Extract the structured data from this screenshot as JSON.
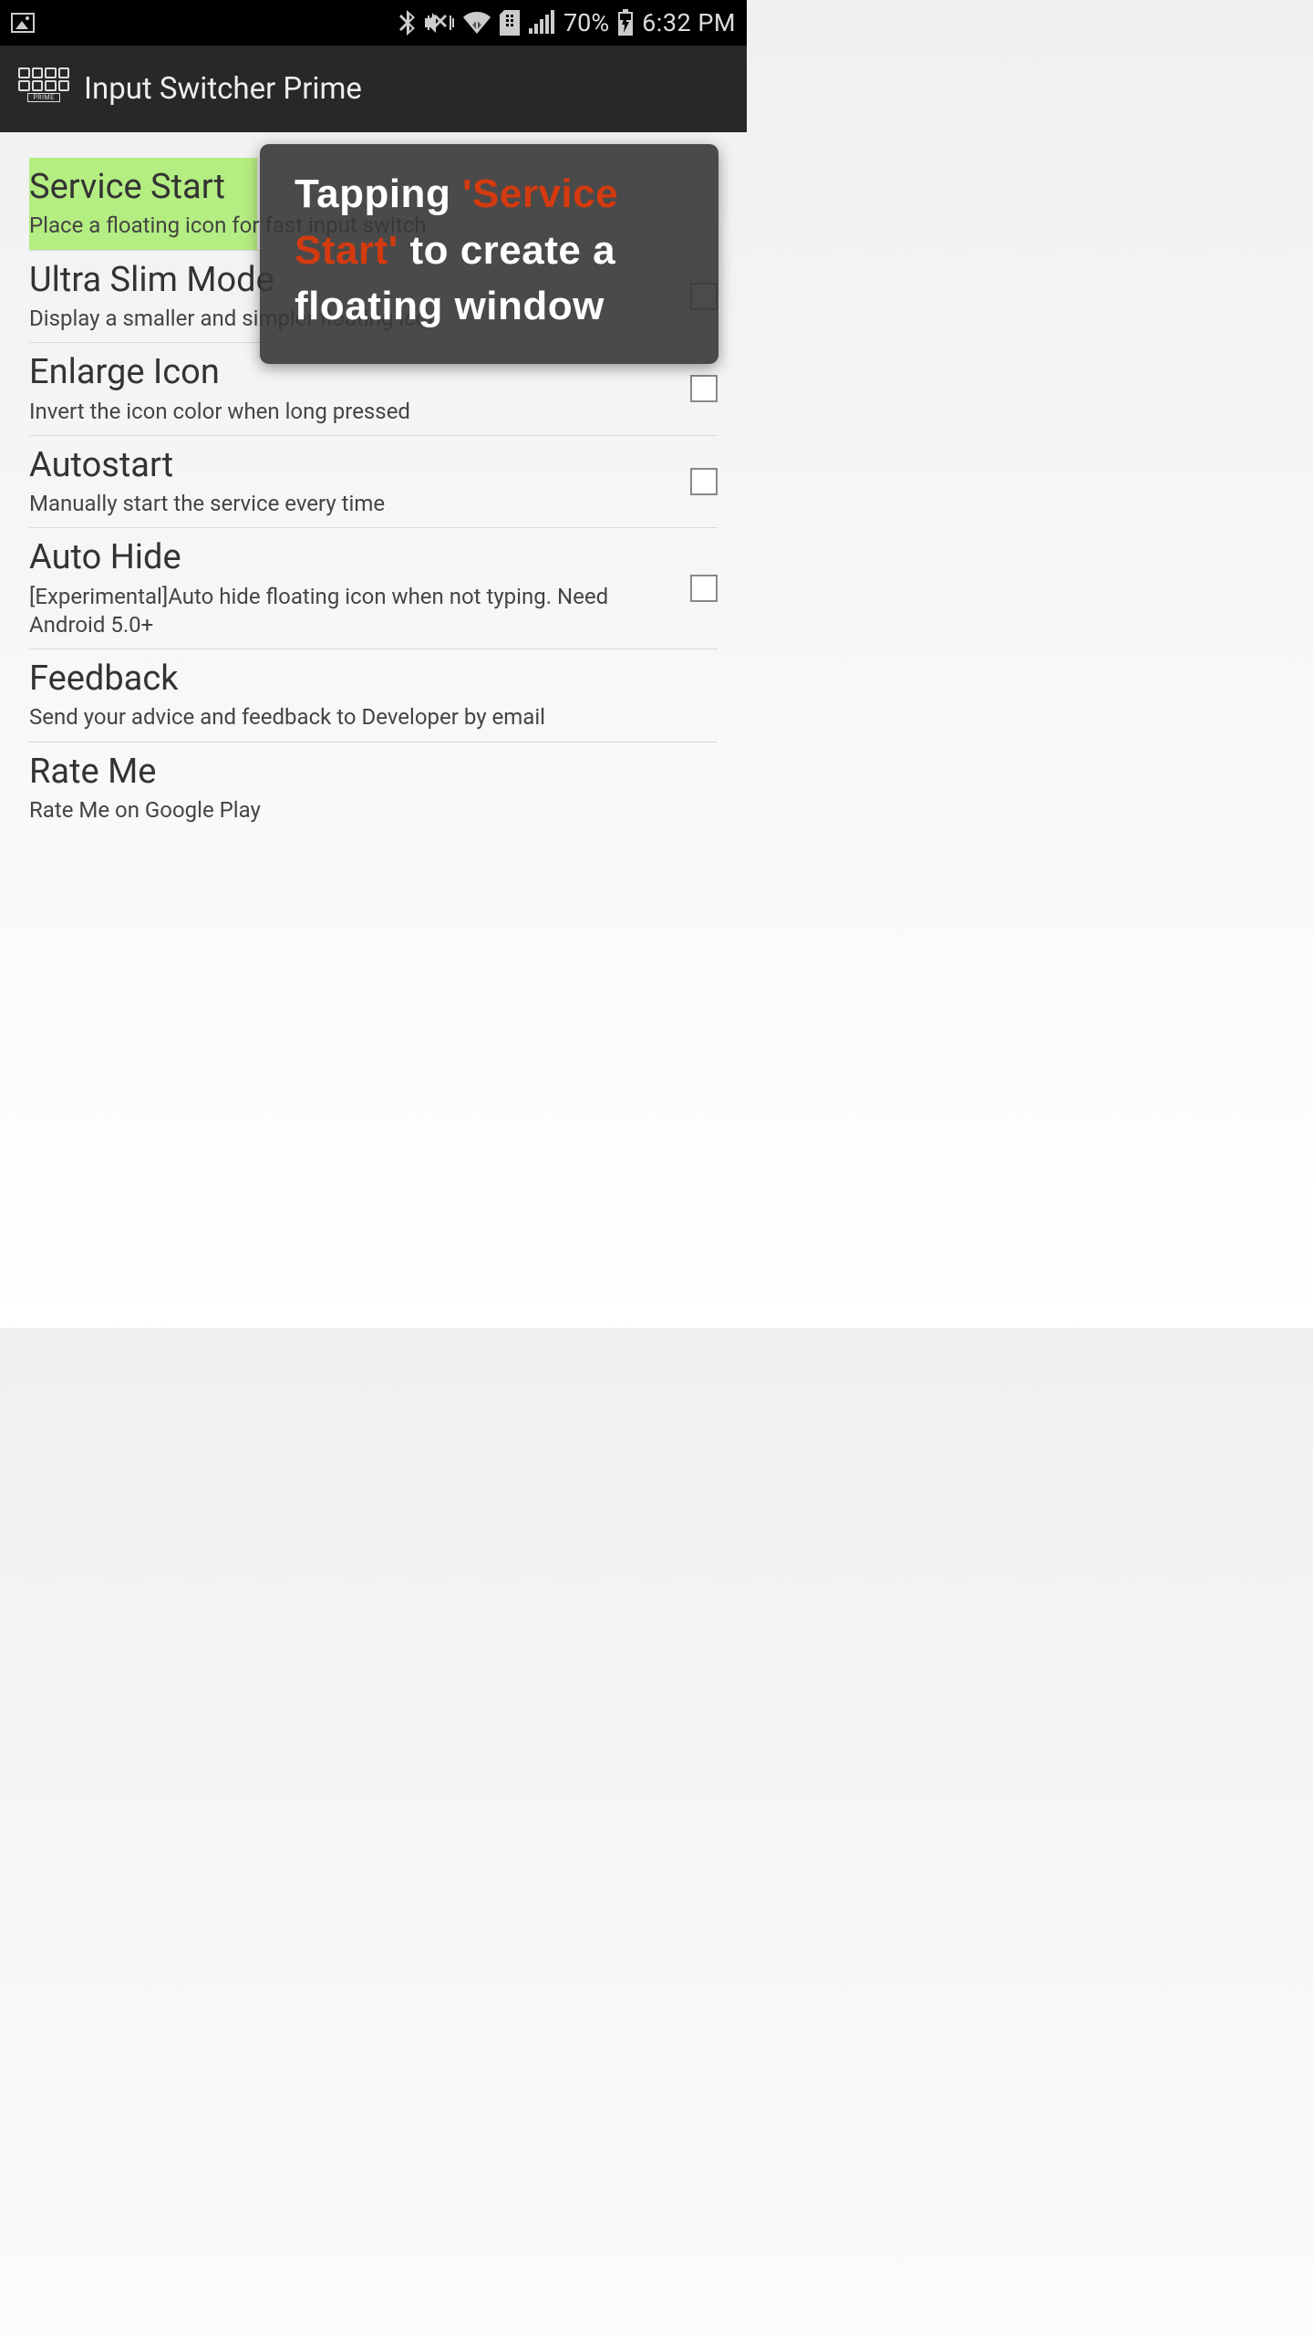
{
  "status": {
    "battery": "70%",
    "time": "6:32 PM"
  },
  "appbar": {
    "title": "Input Switcher Prime",
    "icon_label": "PRIME"
  },
  "items": [
    {
      "title": "Service Start",
      "sub": "Place a floating icon for fast input switch",
      "checkbox": false,
      "highlight": true
    },
    {
      "title": "Ultra Slim Mode",
      "sub": "Display a smaller and simpler floating icon",
      "checkbox": true,
      "highlight": false
    },
    {
      "title": "Enlarge Icon",
      "sub": "Invert the icon color when long pressed",
      "checkbox": true,
      "highlight": false
    },
    {
      "title": "Autostart",
      "sub": "Manually start the service every time",
      "checkbox": true,
      "highlight": false
    },
    {
      "title": "Auto Hide",
      "sub": "[Experimental]Auto hide floating icon when not typing. Need Android 5.0+",
      "checkbox": true,
      "highlight": false
    },
    {
      "title": "Feedback",
      "sub": "Send your advice and feedback to Developer by email",
      "checkbox": false,
      "highlight": false
    },
    {
      "title": "Rate Me",
      "sub": "Rate Me on Google Play",
      "checkbox": false,
      "highlight": false
    }
  ],
  "tooltip": {
    "pre": "Tapping ",
    "highlight": "'Service Start'",
    "post": " to create a floating window"
  }
}
